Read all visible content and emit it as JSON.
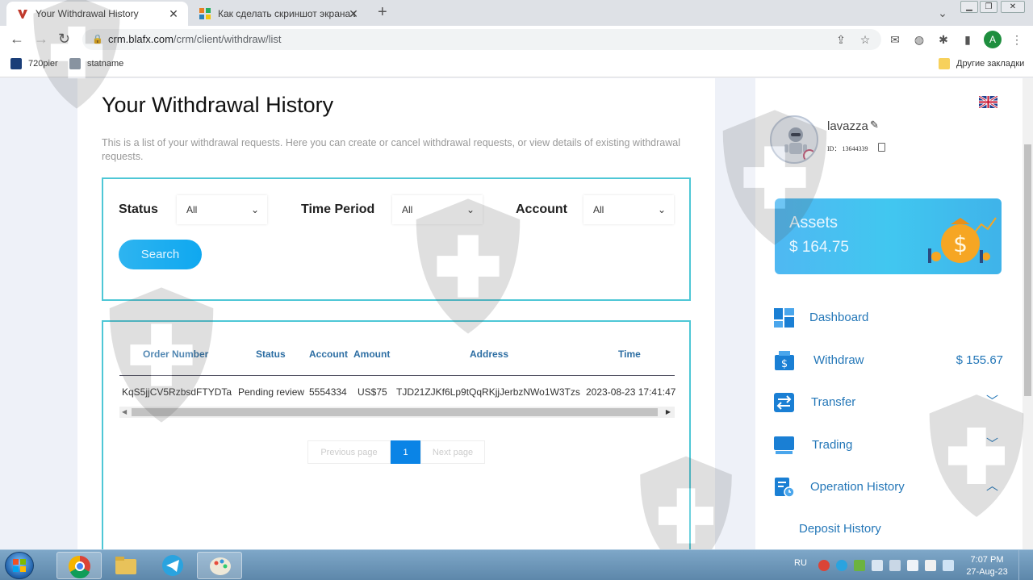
{
  "browser": {
    "tabs": [
      {
        "title": "Your Withdrawal History",
        "active": true
      },
      {
        "title": "Как сделать скриншот экрана в",
        "active": false
      }
    ],
    "url_host": "crm.blafx.com",
    "url_path": "/crm/client/withdraw/list",
    "profile_initial": "A",
    "bookmarks": [
      {
        "label": "720pier"
      },
      {
        "label": "statname"
      },
      {
        "label": "Другие закладки"
      }
    ]
  },
  "page": {
    "title": "Your Withdrawal History",
    "description": "This is a list of your withdrawal requests. Here you can create or cancel withdrawal requests, or view details of existing withdrawal requests.",
    "filters": {
      "status_label": "Status",
      "status_value": "All",
      "period_label": "Time Period",
      "period_value": "All",
      "account_label": "Account",
      "account_value": "All",
      "search_label": "Search"
    },
    "table": {
      "columns": [
        "Order Number",
        "Status",
        "Account",
        "Amount",
        "Address",
        "Time"
      ],
      "rows": [
        [
          "KqS5jjCV5RzbsdFTYDTa",
          "Pending review",
          "5554334",
          "US$75",
          "TJD21ZJKf6Lp9tQqRKjjJerbzNWo1W3Tzs",
          "2023-08-23 17:41:47"
        ]
      ]
    },
    "pagination": {
      "prev": "Previous page",
      "current": "1",
      "next": "Next page"
    }
  },
  "sidebar": {
    "username": "lavazza",
    "user_id": "ID： 13644339",
    "assets_label": "Assets",
    "assets_value": "$ 164.75",
    "nav": [
      {
        "label": "Dashboard",
        "icon": "dashboard-icon"
      },
      {
        "label": "Withdraw",
        "icon": "wallet-icon",
        "value": "$ 155.67"
      },
      {
        "label": "Transfer",
        "icon": "transfer-icon",
        "expanded": false
      },
      {
        "label": "Trading",
        "icon": "monitor-icon",
        "expanded": false
      },
      {
        "label": "Operation History",
        "icon": "history-icon",
        "expanded": true
      }
    ],
    "sub_items": [
      "Deposit History"
    ]
  },
  "taskbar": {
    "language": "RU",
    "time": "7:07 PM",
    "date": "27-Aug-23"
  },
  "colors": {
    "accent": "#4ec7d6",
    "link": "#2477b8",
    "button": "#0fa8f0",
    "pager_active": "#0a84e6"
  }
}
